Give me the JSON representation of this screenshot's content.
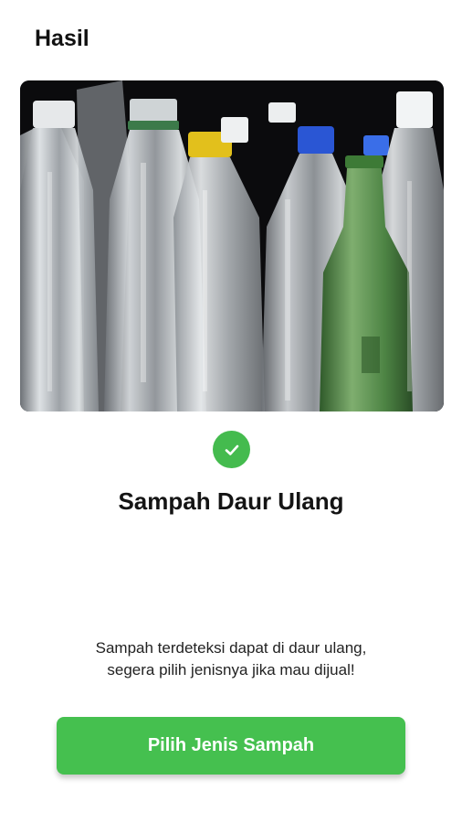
{
  "header": {
    "title": "Hasil"
  },
  "image": {
    "subject": "recyclable-bottles-photo"
  },
  "status": {
    "icon": "check-icon",
    "color": "#44bb4e"
  },
  "result": {
    "title": "Sampah Daur Ulang",
    "description_line1": "Sampah terdeteksi dapat di daur ulang,",
    "description_line2": "segera pilih jenisnya jika mau dijual!"
  },
  "actions": {
    "primary_label": "Pilih Jenis Sampah",
    "primary_color": "#45c04f"
  }
}
